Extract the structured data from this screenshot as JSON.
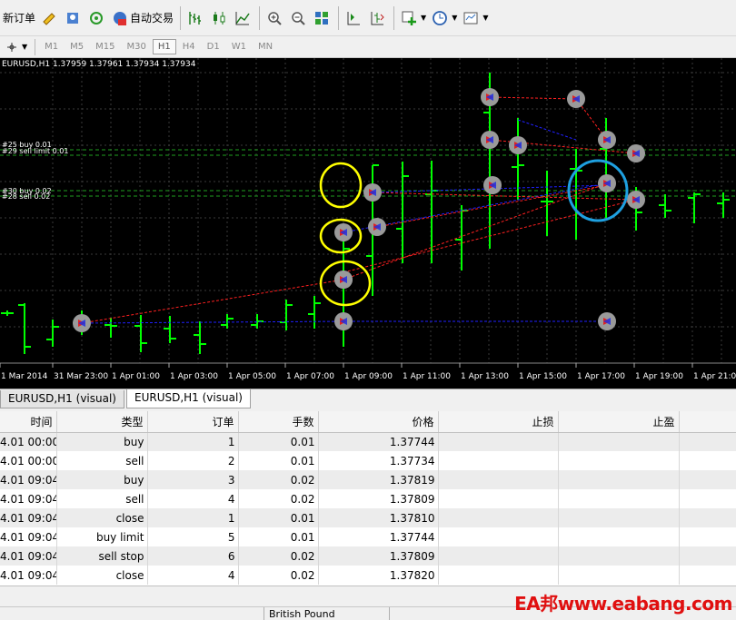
{
  "toolbar": {
    "new_order": "新订单",
    "auto_trading": "自动交易",
    "timeframes": [
      "M1",
      "M5",
      "M15",
      "M30",
      "H1",
      "H4",
      "D1",
      "W1",
      "MN"
    ],
    "active_timeframe": "H1"
  },
  "chart": {
    "title": "EURUSD,H1  1.37959 1.37961 1.37934 1.37934",
    "hlines": [
      {
        "label": "#25 buy 0.01"
      },
      {
        "label": "#29 sell limit 0.01"
      },
      {
        "label": "#30 buy 0.02"
      },
      {
        "label": "#28 sell 0.02"
      }
    ],
    "time_labels": [
      "1 Mar 2014",
      "31 Mar 23:00",
      "1 Apr 01:00",
      "1 Apr 03:00",
      "1 Apr 05:00",
      "1 Apr 07:00",
      "1 Apr 09:00",
      "1 Apr 11:00",
      "1 Apr 13:00",
      "1 Apr 15:00",
      "1 Apr 17:00",
      "1 Apr 19:00",
      "1 Apr 21:00"
    ],
    "colors": {
      "background": "#000000",
      "bar": "#00ff00",
      "grid": "#3a3a3a",
      "buy_line": "#2020ff",
      "sell_line": "#ff2020",
      "marker": "#9a9a9a",
      "highlight_yellow": "#ffff00",
      "highlight_blue": "#1ea0e0"
    }
  },
  "tabs": [
    {
      "label": "EURUSD,H1 (visual)",
      "active": false
    },
    {
      "label": "EURUSD,H1 (visual)",
      "active": true
    }
  ],
  "table": {
    "headers": [
      "时间",
      "类型",
      "订单",
      "手数",
      "价格",
      "止损",
      "止盈"
    ],
    "rows": [
      [
        "4.01 00:00",
        "buy",
        "1",
        "0.01",
        "1.37744",
        "",
        ""
      ],
      [
        "4.01 00:00",
        "sell",
        "2",
        "0.01",
        "1.37734",
        "",
        ""
      ],
      [
        "4.01 09:04",
        "buy",
        "3",
        "0.02",
        "1.37819",
        "",
        ""
      ],
      [
        "4.01 09:04",
        "sell",
        "4",
        "0.02",
        "1.37809",
        "",
        ""
      ],
      [
        "4.01 09:04",
        "close",
        "1",
        "0.01",
        "1.37810",
        "",
        ""
      ],
      [
        "4.01 09:04",
        "buy limit",
        "5",
        "0.01",
        "1.37744",
        "",
        ""
      ],
      [
        "4.01 09:04",
        "sell stop",
        "6",
        "0.02",
        "1.37809",
        "",
        ""
      ],
      [
        "4.01 09:04",
        "close",
        "4",
        "0.02",
        "1.37820",
        "",
        ""
      ]
    ]
  },
  "status": {
    "symbol_name": "British Pound"
  },
  "watermark": "EA邦www.eabang.com"
}
